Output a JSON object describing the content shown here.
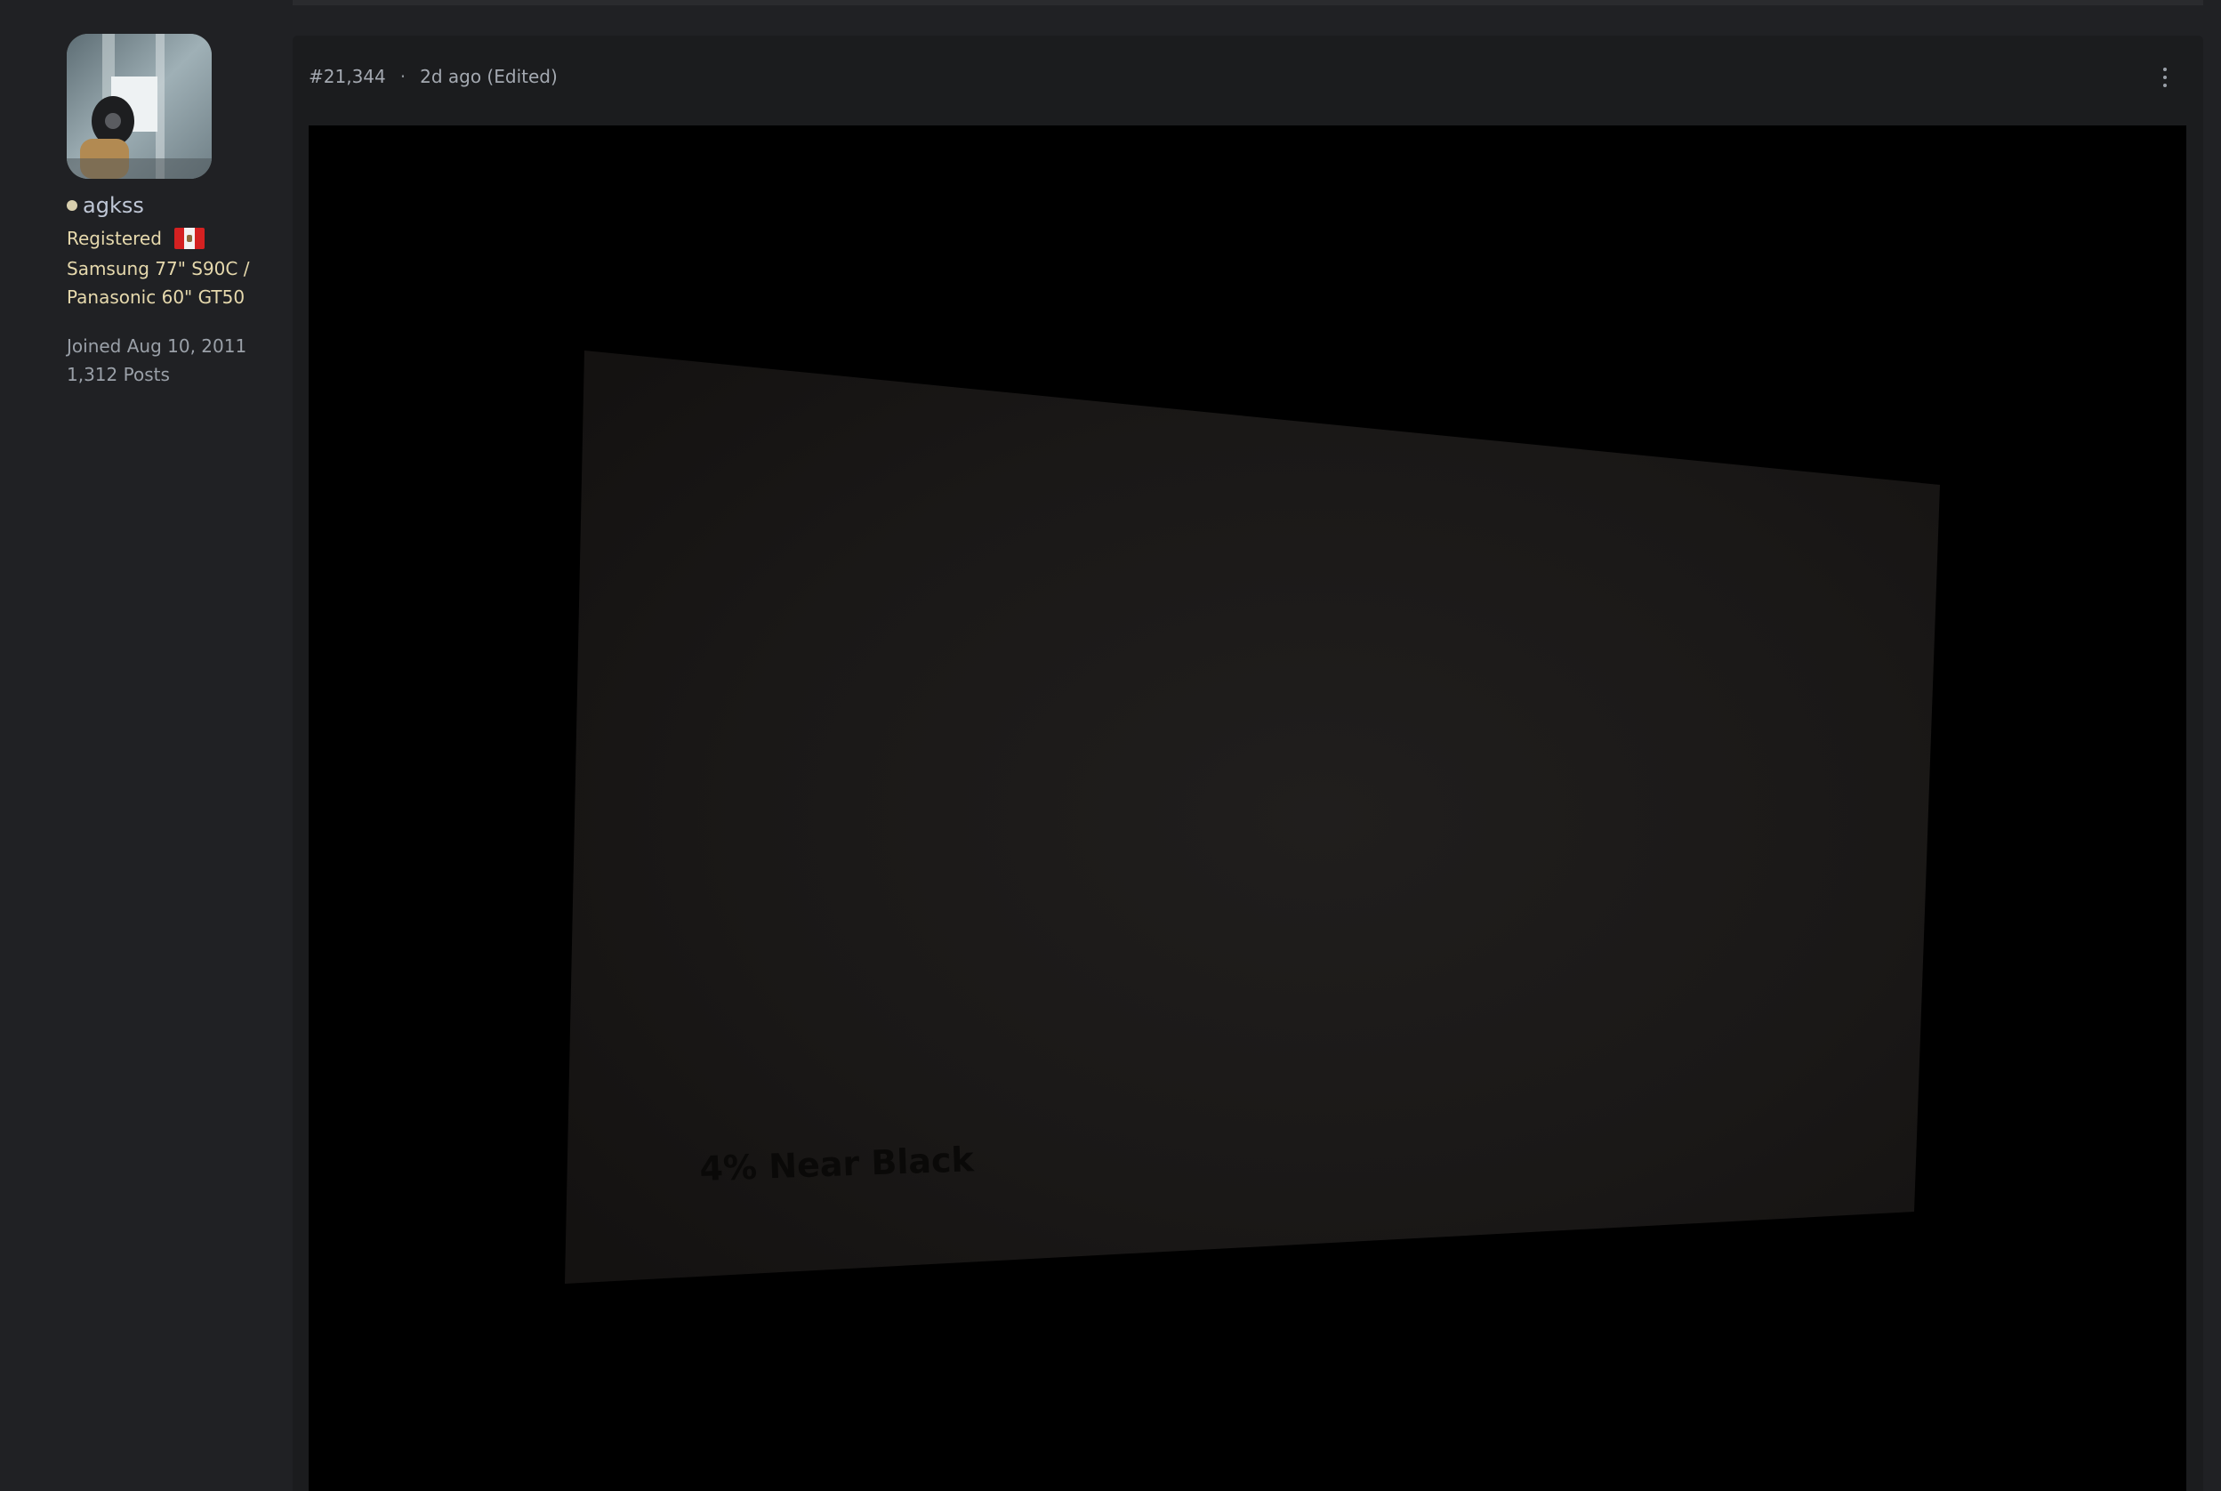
{
  "user": {
    "username": "agkss",
    "role": "Registered",
    "signature_line1": "Samsung 77\" S90C /",
    "signature_line2": "Panasonic 60\" GT50",
    "joined": "Joined Aug 10, 2011",
    "posts": "1,312 Posts",
    "status_color": "#d8cfae",
    "flag_icon": "peru-flag-icon"
  },
  "post": {
    "number": "#21,344",
    "separator": "·",
    "time": "2d ago (Edited)",
    "menu_icon": "more-vertical-icon",
    "image": {
      "caption_text": "4% Near Black"
    }
  },
  "colors": {
    "background": "#202124",
    "panel": "#1b1c1e",
    "role_text": "#e6d9ad",
    "username_text": "#bfc7d6",
    "meta_text": "#a4a9b1"
  }
}
